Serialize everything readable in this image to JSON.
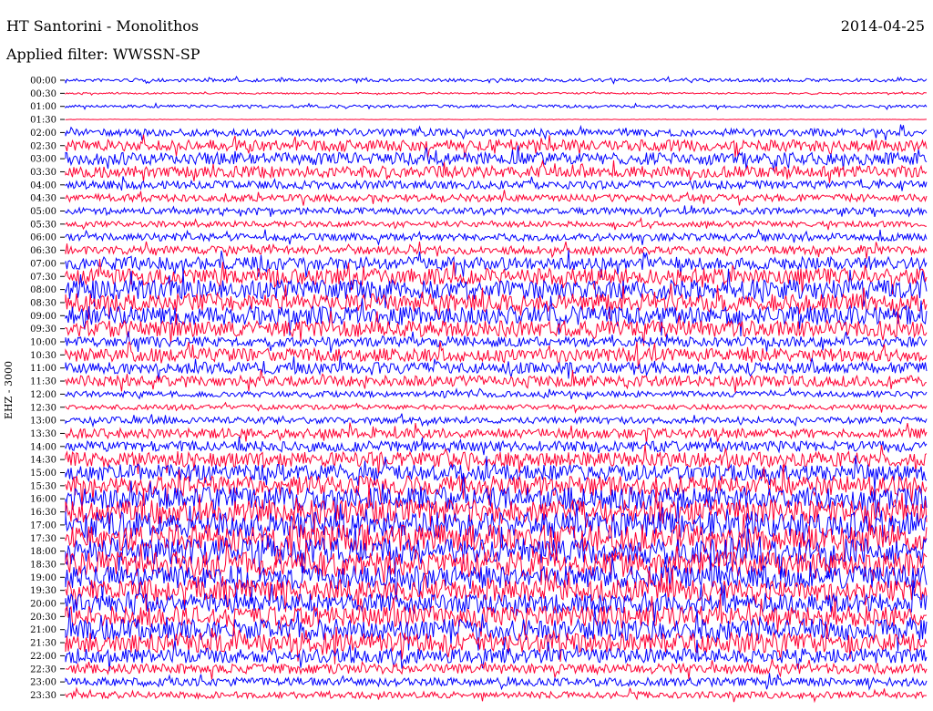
{
  "header": {
    "station": "HT Santorini - Monolithos",
    "date": "2014-04-25",
    "filter": "Applied filter: WWSSN-SP",
    "channel": "EHZ - 3000"
  },
  "colors": {
    "trace_a": "#0000ff",
    "trace_b": "#ff0033"
  },
  "chart_data": {
    "type": "line",
    "title": "HT Santorini - Monolithos",
    "subtitle": "Applied filter: WWSSN-SP",
    "ylabel": "EHZ - 3000",
    "row_labels": [
      "00:00",
      "00:30",
      "01:00",
      "01:30",
      "02:00",
      "02:30",
      "03:00",
      "03:30",
      "04:00",
      "04:30",
      "05:00",
      "05:30",
      "06:00",
      "06:30",
      "07:00",
      "07:30",
      "08:00",
      "08:30",
      "09:00",
      "09:30",
      "10:00",
      "10:30",
      "11:00",
      "11:30",
      "12:00",
      "12:30",
      "13:00",
      "13:30",
      "14:00",
      "14:30",
      "15:00",
      "15:30",
      "16:00",
      "16:30",
      "17:00",
      "17:30",
      "18:00",
      "18:30",
      "19:00",
      "19:30",
      "20:00",
      "20:30",
      "21:00",
      "21:30",
      "22:00",
      "22:30",
      "23:00",
      "23:30"
    ],
    "relative_amplitude": [
      0.4,
      0.2,
      0.35,
      0.05,
      0.9,
      1.4,
      1.5,
      1.4,
      1.0,
      0.9,
      0.8,
      0.7,
      0.9,
      1.0,
      1.6,
      2.0,
      2.4,
      2.2,
      2.3,
      2.0,
      1.2,
      1.6,
      1.4,
      1.3,
      0.7,
      0.6,
      0.8,
      1.2,
      1.3,
      1.8,
      2.0,
      2.4,
      2.8,
      3.0,
      3.2,
      3.3,
      3.2,
      3.1,
      2.8,
      2.6,
      2.4,
      2.5,
      2.6,
      2.4,
      1.8,
      1.2,
      1.0,
      0.8
    ],
    "grid": false
  }
}
